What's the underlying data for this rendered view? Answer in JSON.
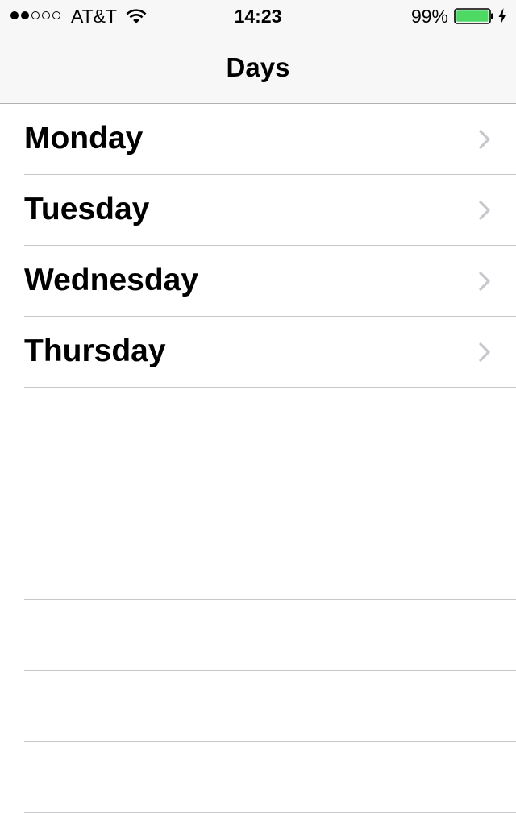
{
  "status_bar": {
    "carrier": "AT&T",
    "time": "14:23",
    "battery_percent": "99%",
    "signal_bars_filled": 2,
    "signal_bars_total": 5,
    "battery_level": 0.99,
    "battery_color": "#4cd964",
    "icons": [
      "wifi-icon",
      "battery-icon",
      "charging-icon"
    ]
  },
  "nav": {
    "title": "Days"
  },
  "days": [
    {
      "label": "Monday",
      "accessory": "chevron-right-icon"
    },
    {
      "label": "Tuesday",
      "accessory": "chevron-right-icon"
    },
    {
      "label": "Wednesday",
      "accessory": "chevron-right-icon"
    },
    {
      "label": "Thursday",
      "accessory": "chevron-right-icon"
    }
  ],
  "colors": {
    "chrome_background": "#f7f7f7",
    "separator": "#c8c7cc",
    "chevron": "#c7c7cc"
  }
}
